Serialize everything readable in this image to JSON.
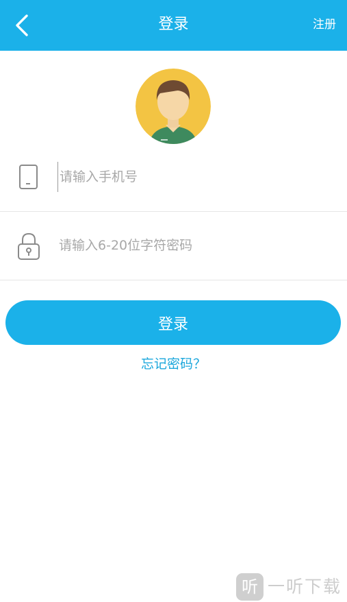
{
  "header": {
    "title": "登录",
    "register_label": "注册",
    "back_icon": "chevron-left-icon"
  },
  "form": {
    "phone_placeholder": "请输入手机号",
    "password_placeholder": "请输入6-20位字符密码",
    "phone_icon": "phone-icon",
    "lock_icon": "lock-icon"
  },
  "actions": {
    "login_label": "登录",
    "forgot_label": "忘记密码？"
  },
  "watermark": {
    "logo_char": "听",
    "text": "一听下载"
  },
  "colors": {
    "primary": "#1bb1e9",
    "link": "#1ba7dc",
    "placeholder": "#a8a8a8",
    "avatar_bg": "#f3c443"
  }
}
